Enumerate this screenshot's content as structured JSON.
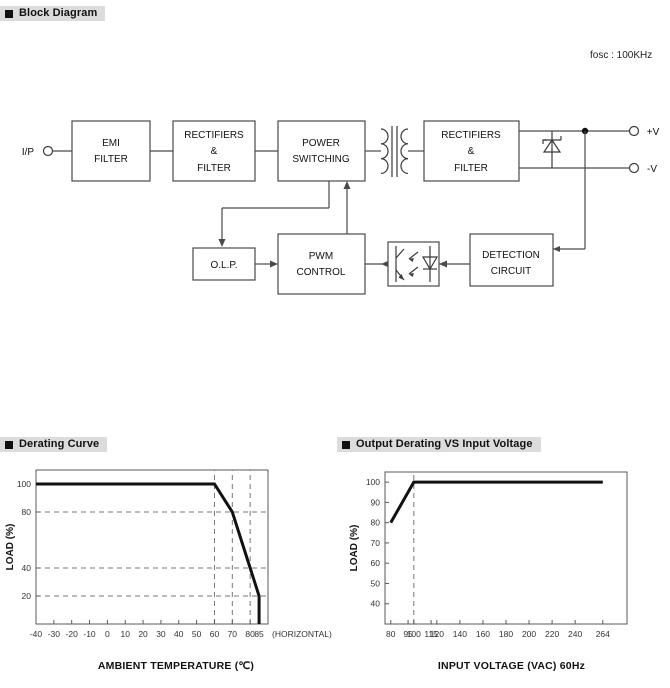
{
  "sections": {
    "block_diagram": {
      "title": "Block Diagram"
    },
    "derating_curve": {
      "title": "Derating Curve"
    },
    "output_derating": {
      "title": "Output Derating VS Input Voltage"
    }
  },
  "block_diagram": {
    "fosc_note": "fosc : 100KHz",
    "input_label": "I/P",
    "output_labels": {
      "positive": "+V",
      "negative": "-V"
    },
    "blocks": [
      {
        "id": "emi-filter",
        "lines": [
          "EMI",
          "FILTER"
        ]
      },
      {
        "id": "rectifiers-filter-in",
        "lines": [
          "RECTIFIERS",
          "&",
          "FILTER"
        ]
      },
      {
        "id": "power-switching",
        "lines": [
          "POWER",
          "SWITCHING"
        ]
      },
      {
        "id": "rectifiers-filter-out",
        "lines": [
          "RECTIFIERS",
          "&",
          "FILTER"
        ]
      },
      {
        "id": "olp",
        "lines": [
          "O.L.P."
        ]
      },
      {
        "id": "pwm-control",
        "lines": [
          "PWM",
          "CONTROL"
        ]
      },
      {
        "id": "detection-circuit",
        "lines": [
          "DETECTION",
          "CIRCUIT"
        ]
      }
    ],
    "symbols": [
      "transformer",
      "zener-diode",
      "optocoupler",
      "input-terminal",
      "output-terminal-positive",
      "output-terminal-negative"
    ]
  },
  "chart_data": [
    {
      "id": "derating-curve",
      "type": "line",
      "title": "Derating Curve",
      "xlabel": "AMBIENT TEMPERATURE (℃)",
      "ylabel": "LOAD (%)",
      "xlim": [
        -40,
        90
      ],
      "ylim": [
        0,
        110
      ],
      "xticks": [
        -40,
        -30,
        -20,
        -10,
        0,
        10,
        20,
        30,
        40,
        50,
        60,
        70,
        80,
        85
      ],
      "xticklabels": [
        "-40",
        "-30",
        "-20",
        "-10",
        "0",
        "10",
        "20",
        "30",
        "40",
        "50",
        "60",
        "70",
        "80",
        "85"
      ],
      "yticks": [
        20,
        40,
        80,
        100
      ],
      "yticklabels": [
        "20",
        "40",
        "80",
        "100"
      ],
      "annotation": "(HORIZONTAL)",
      "grid": "dashed-horizontal-and-vertical-guides",
      "guides_x": [
        60,
        70,
        80
      ],
      "guides_y": [
        20,
        40,
        80
      ],
      "series": [
        {
          "name": "HORIZONTAL",
          "x": [
            -40,
            60,
            70,
            80,
            85,
            85
          ],
          "y": [
            100,
            100,
            80,
            40,
            20,
            0
          ]
        }
      ]
    },
    {
      "id": "output-derating-vs-input-voltage",
      "type": "line",
      "title": "Output Derating VS Input Voltage",
      "xlabel": "INPUT VOLTAGE (VAC) 60Hz",
      "ylabel": "LOAD (%)",
      "xlim": [
        75,
        285
      ],
      "ylim": [
        30,
        105
      ],
      "xticks": [
        80,
        95,
        100,
        115,
        120,
        140,
        160,
        180,
        200,
        220,
        240,
        264
      ],
      "xticklabels": [
        "80",
        "95",
        "100",
        "115",
        "120",
        "140",
        "160",
        "180",
        "200",
        "220",
        "240",
        "264"
      ],
      "yticks": [
        40,
        50,
        60,
        70,
        80,
        90,
        100
      ],
      "yticklabels": [
        "40",
        "50",
        "60",
        "70",
        "80",
        "90",
        "100"
      ],
      "grid": "dashed-vertical-guide",
      "guides_x": [
        100
      ],
      "series": [
        {
          "name": "load",
          "x": [
            80,
            100,
            264
          ],
          "y": [
            80,
            100,
            100
          ]
        }
      ]
    }
  ]
}
